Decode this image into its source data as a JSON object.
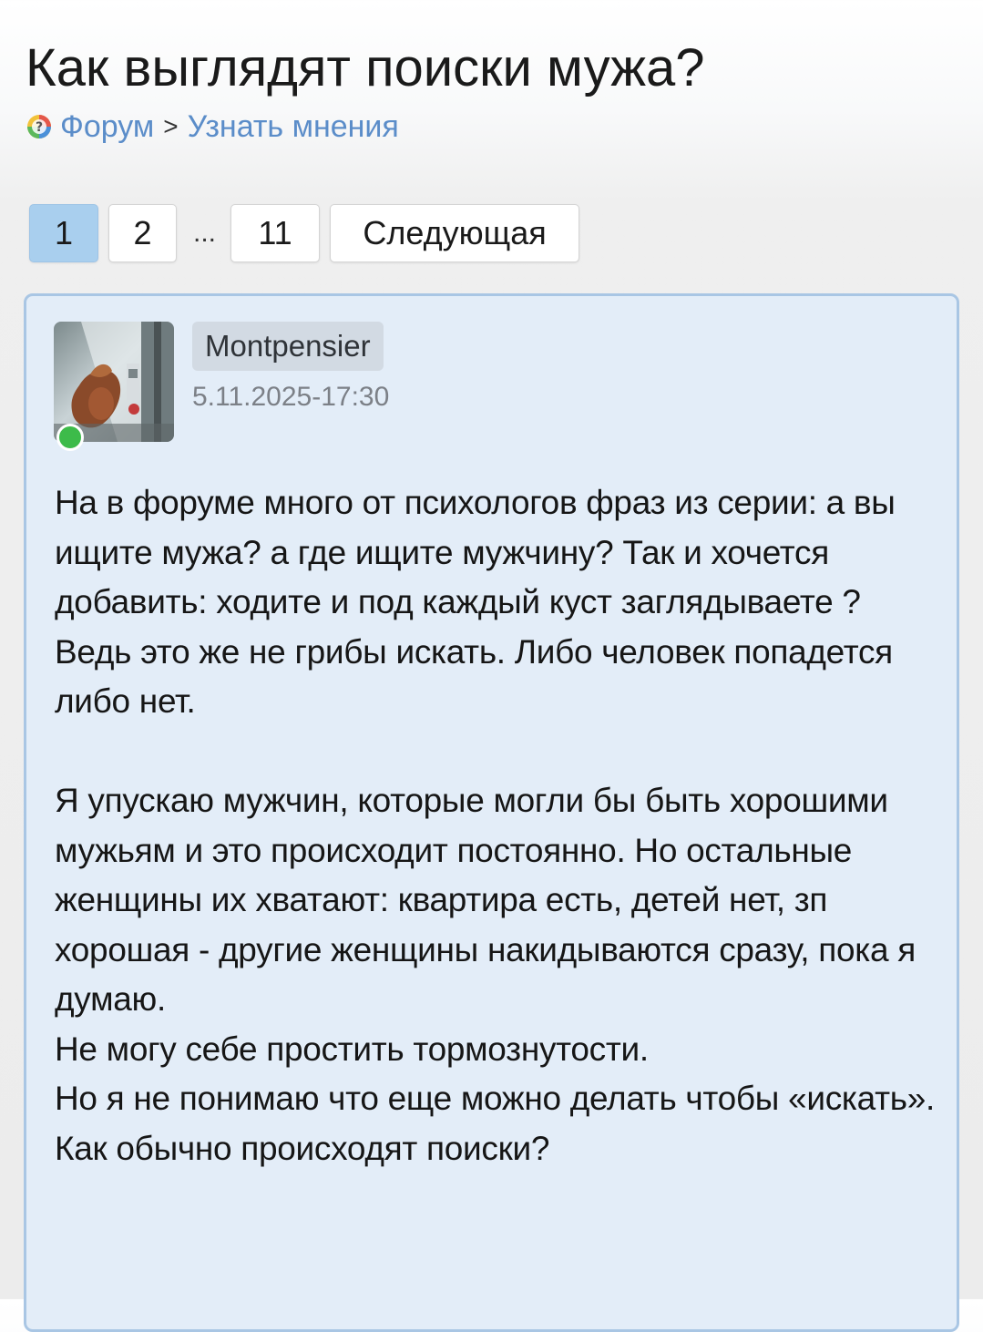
{
  "page": {
    "title": "Как выглядят поиски мужа?"
  },
  "breadcrumb": {
    "forum_label": "Форум",
    "separator": ">",
    "section_label": "Узнать мнения"
  },
  "pagination": {
    "pages": [
      "1",
      "2"
    ],
    "ellipsis": "...",
    "last_page": "11",
    "next_label": "Следующая",
    "active_page": "1"
  },
  "post": {
    "author": "Montpensier",
    "date": "5.11.2025-17:30",
    "online": true,
    "body": "На в форуме много от психологов фраз из серии: а вы ищите мужа? а где ищите мужчину? Так и хочется добавить: ходите и под каждый куст заглядываете ?\nВедь это же не грибы искать. Либо человек попадется либо нет.\n\nЯ упускаю мужчин, которые могли бы быть хорошими мужьям и это происходит постоянно. Но остальные женщины их хватают: квартира есть, детей нет, зп хорошая - другие женщины накидываются сразу, пока я думаю.\nНе могу себе простить тормознутости.\nНо я не понимаю что еще можно делать чтобы «искать».\nКак обычно происходят поиски?"
  },
  "colors": {
    "link": "#5b8dc9",
    "active_page_bg": "#a9cfee",
    "post_bg": "#e3edf8",
    "post_border": "#a9c6e4",
    "online": "#3dbb4a"
  }
}
